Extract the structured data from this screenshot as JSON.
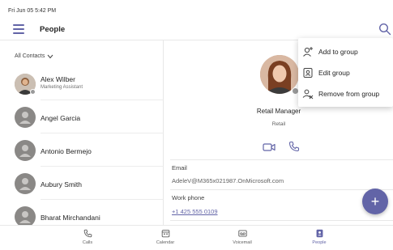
{
  "status_bar": {
    "time": "Fri Jun 05  5:42 PM"
  },
  "header": {
    "title": "People"
  },
  "contacts": {
    "filter_label": "All Contacts",
    "items": [
      {
        "name": "Alex Wilber",
        "subtitle": "Marketing Assistant",
        "has_photo": true
      },
      {
        "name": "Angel Garcia",
        "subtitle": "",
        "has_photo": false
      },
      {
        "name": "Antonio Bermejo",
        "subtitle": "",
        "has_photo": false
      },
      {
        "name": "Aubury Smith",
        "subtitle": "",
        "has_photo": false
      },
      {
        "name": "Bharat Mirchandani",
        "subtitle": "",
        "has_photo": false
      }
    ]
  },
  "profile": {
    "job_title": "Retail Manager",
    "department": "Retail",
    "email_label": "Email",
    "email_value": "AdeleV@M365x021987.OnMicrosoft.com",
    "phone_label": "Work phone",
    "phone_value": "+1 425 555 0109"
  },
  "menu": {
    "items": [
      {
        "label": "Add to group",
        "icon": "add-person-icon"
      },
      {
        "label": "Edit group",
        "icon": "edit-group-icon"
      },
      {
        "label": "Remove from group",
        "icon": "remove-person-icon"
      }
    ]
  },
  "bottom_nav": {
    "items": [
      {
        "label": "Calls",
        "icon": "phone-icon",
        "active": false
      },
      {
        "label": "Calendar",
        "icon": "calendar-icon",
        "active": false
      },
      {
        "label": "Voicemail",
        "icon": "voicemail-icon",
        "active": false
      },
      {
        "label": "People",
        "icon": "people-icon",
        "active": true
      }
    ]
  },
  "colors": {
    "accent": "#6264a7",
    "presence_offline": "#9a9a9a",
    "divider": "#e8e8e8"
  }
}
